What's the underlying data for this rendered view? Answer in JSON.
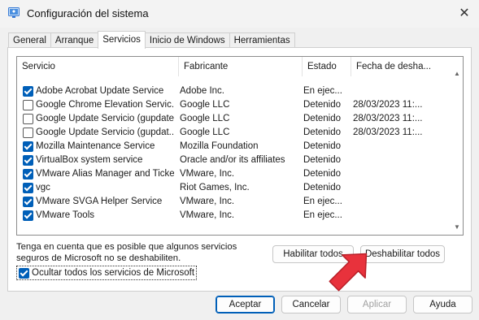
{
  "window": {
    "title": "Configuración del sistema",
    "close_glyph": "✕",
    "app_icon": "system-config-icon"
  },
  "tabs": [
    {
      "label": "General",
      "active": false
    },
    {
      "label": "Arranque",
      "active": false
    },
    {
      "label": "Servicios",
      "active": true
    },
    {
      "label": "Inicio de Windows",
      "active": false
    },
    {
      "label": "Herramientas",
      "active": false
    }
  ],
  "services_list": {
    "headers": {
      "service": "Servicio",
      "manufacturer": "Fabricante",
      "status": "Estado",
      "disabled_date": "Fecha de desha..."
    },
    "rows": [
      {
        "checked": true,
        "name": "Adobe Acrobat Update Service",
        "manufacturer": "Adobe Inc.",
        "status": "En ejec...",
        "date": ""
      },
      {
        "checked": false,
        "name": "Google Chrome Elevation Servic...",
        "manufacturer": "Google LLC",
        "status": "Detenido",
        "date": "28/03/2023 11:..."
      },
      {
        "checked": false,
        "name": "Google Update Servicio (gupdate)",
        "manufacturer": "Google LLC",
        "status": "Detenido",
        "date": "28/03/2023 11:..."
      },
      {
        "checked": false,
        "name": "Google Update Servicio (gupdat...",
        "manufacturer": "Google LLC",
        "status": "Detenido",
        "date": "28/03/2023 11:..."
      },
      {
        "checked": true,
        "name": "Mozilla Maintenance Service",
        "manufacturer": "Mozilla Foundation",
        "status": "Detenido",
        "date": ""
      },
      {
        "checked": true,
        "name": "VirtualBox system service",
        "manufacturer": "Oracle and/or its affiliates",
        "status": "Detenido",
        "date": ""
      },
      {
        "checked": true,
        "name": "VMware Alias Manager and Ticke...",
        "manufacturer": "VMware, Inc.",
        "status": "Detenido",
        "date": ""
      },
      {
        "checked": true,
        "name": "vgc",
        "manufacturer": "Riot Games, Inc.",
        "status": "Detenido",
        "date": ""
      },
      {
        "checked": true,
        "name": "VMware SVGA Helper Service",
        "manufacturer": "VMware, Inc.",
        "status": "En ejec...",
        "date": ""
      },
      {
        "checked": true,
        "name": "VMware Tools",
        "manufacturer": "VMware, Inc.",
        "status": "En ejec...",
        "date": ""
      }
    ]
  },
  "note": "Tenga en cuenta que es posible que algunos servicios seguros de Microsoft no se deshabiliten.",
  "buttons": {
    "enable_all": "Habilitar todos",
    "disable_all": "Deshabilitar todos",
    "ok": "Aceptar",
    "cancel": "Cancelar",
    "apply": "Aplicar",
    "help": "Ayuda"
  },
  "hide_microsoft": {
    "label": "Ocultar todos los servicios de Microsoft",
    "checked": true
  },
  "colors": {
    "accent": "#005fb8",
    "annotation_arrow": "#e8323c"
  }
}
